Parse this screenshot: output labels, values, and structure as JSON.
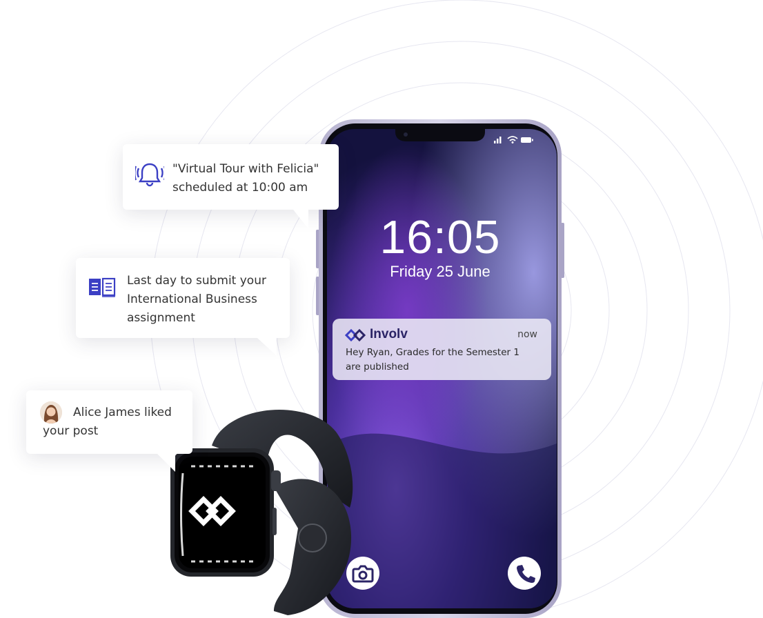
{
  "notifications": {
    "tour": {
      "line1": "\"Virtual Tour with Felicia\"",
      "line2": "scheduled at 10:00 am",
      "icon": "bell-ringing-icon"
    },
    "assignment": {
      "line1": "Last day to submit your",
      "line2": "International Business",
      "line3": "assignment",
      "icon": "open-book-icon"
    },
    "like": {
      "line1": "Alice James liked",
      "line2": "your post",
      "icon": "user-avatar"
    }
  },
  "phone": {
    "time": "16:05",
    "date": "Friday 25 June",
    "notification": {
      "app_name": "Involv",
      "when": "now",
      "line1": "Hey Ryan, Grades for the Semester 1",
      "line2": "are published"
    },
    "buttons": {
      "camera": "camera-icon",
      "call": "phone-call-icon"
    }
  },
  "watch": {
    "logo": "involv-logo-icon"
  },
  "colors": {
    "accent": "#3b3fc4",
    "brand_dark": "#2b2466",
    "screen_top": "#2a2a7a",
    "screen_purple": "#7a4ed8"
  }
}
